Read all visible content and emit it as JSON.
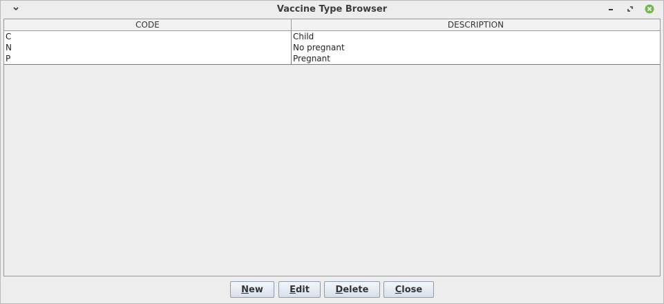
{
  "window": {
    "title": "Vaccine Type Browser",
    "icons": [
      "chevron-down-icon",
      "minimize-icon",
      "restore-icon",
      "close-icon"
    ],
    "close_color": "#73b84a"
  },
  "table": {
    "columns": [
      "CODE",
      "DESCRIPTION"
    ],
    "rows": [
      {
        "code": "C",
        "description": "Child"
      },
      {
        "code": "N",
        "description": "No pregnant"
      },
      {
        "code": "P",
        "description": "Pregnant"
      }
    ]
  },
  "buttons": {
    "new": {
      "mnemonic": "N",
      "rest": "ew"
    },
    "edit": {
      "mnemonic": "E",
      "rest": "dit"
    },
    "delete": {
      "mnemonic": "D",
      "rest": "elete"
    },
    "close": {
      "mnemonic": "C",
      "rest": "lose"
    }
  }
}
